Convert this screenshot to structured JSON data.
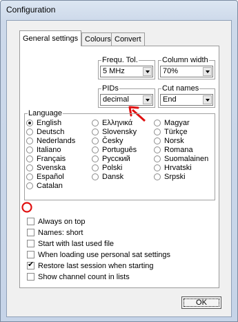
{
  "window": {
    "title": "Configuration"
  },
  "tabs": [
    {
      "label": "General settings",
      "active": true
    },
    {
      "label": "Colours",
      "active": false
    },
    {
      "label": "Convert",
      "active": false
    }
  ],
  "frequ_tol": {
    "label": "Frequ. Tol.",
    "value": "5 MHz"
  },
  "column_width": {
    "label": "Column width",
    "value": "70%"
  },
  "pids": {
    "label": "PIDs",
    "value": "decimal"
  },
  "cut_names": {
    "label": "Cut names",
    "value": "End"
  },
  "language": {
    "label": "Language",
    "selected": "English",
    "col1": [
      "English",
      "Deutsch",
      "Nederlands",
      "Italiano",
      "Français",
      "Svenska",
      "Español",
      "Catalan"
    ],
    "col2": [
      "Ελληνικά",
      "Slovensky",
      "Česky",
      "Português",
      "Русский",
      "Polski",
      "Dansk"
    ],
    "col3": [
      "Magyar",
      "Türkçe",
      "Norsk",
      "Romana",
      "Suomalainen",
      "Hrvatski",
      "Srpski"
    ]
  },
  "options": [
    {
      "label": "Always on top",
      "checked": false
    },
    {
      "label": "Names: short",
      "checked": false
    },
    {
      "label": "Start with last used file",
      "checked": false
    },
    {
      "label": "When loading use personal sat settings",
      "checked": false
    },
    {
      "label": "Restore last session when starting",
      "checked": true
    },
    {
      "label": "Show channel count in lists",
      "checked": false
    }
  ],
  "ok_label": "OK",
  "colors": {
    "annotation_red": "#e01010"
  }
}
